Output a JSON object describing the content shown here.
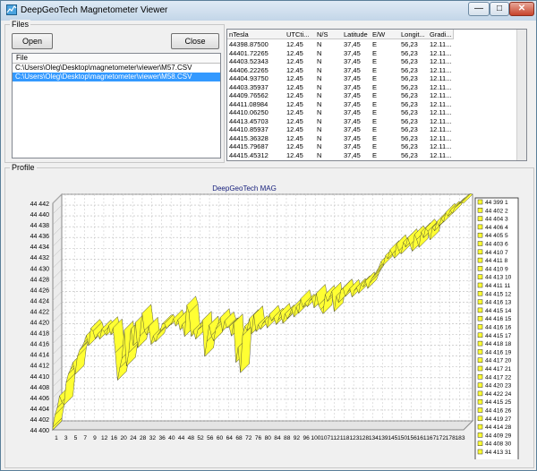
{
  "window": {
    "title": "DeepGeoTech Magnetometer Viewer",
    "min_glyph": "—",
    "max_glyph": "□",
    "close_glyph": "✕"
  },
  "files_group": {
    "legend": "Files",
    "open_label": "Open",
    "close_label": "Close",
    "list_header": "File",
    "items": [
      "C:\\Users\\Oleg\\Desktop\\magnetometer\\viewer\\M57.CSV",
      "C:\\Users\\Oleg\\Desktop\\magnetometer\\viewer\\M58.CSV"
    ],
    "selected": 1
  },
  "data_grid": {
    "columns": [
      "nTesla",
      "UTCti...",
      "N/S",
      "Latitude",
      "E/W",
      "Longit...",
      "Gradi..."
    ],
    "rows": [
      [
        "44398.87500",
        "12.45",
        "N",
        "37,45",
        "E",
        "56,23",
        "12.11..."
      ],
      [
        "44401.72265",
        "12.45",
        "N",
        "37,45",
        "E",
        "56,23",
        "12.11..."
      ],
      [
        "44403.52343",
        "12.45",
        "N",
        "37,45",
        "E",
        "56,23",
        "12.11..."
      ],
      [
        "44406.22265",
        "12.45",
        "N",
        "37,45",
        "E",
        "56,23",
        "12.11..."
      ],
      [
        "44404.93750",
        "12.45",
        "N",
        "37,45",
        "E",
        "56,23",
        "12.11..."
      ],
      [
        "44403.35937",
        "12.45",
        "N",
        "37,45",
        "E",
        "56,23",
        "12.11..."
      ],
      [
        "44409.76562",
        "12.45",
        "N",
        "37,45",
        "E",
        "56,23",
        "12.11..."
      ],
      [
        "44411.08984",
        "12.45",
        "N",
        "37,45",
        "E",
        "56,23",
        "12.11..."
      ],
      [
        "44410.06250",
        "12.45",
        "N",
        "37,45",
        "E",
        "56,23",
        "12.11..."
      ],
      [
        "44413.45703",
        "12.45",
        "N",
        "37,45",
        "E",
        "56,23",
        "12.11..."
      ],
      [
        "44410.85937",
        "12.45",
        "N",
        "37,45",
        "E",
        "56,23",
        "12.11..."
      ],
      [
        "44415.36328",
        "12.45",
        "N",
        "37,45",
        "E",
        "56,23",
        "12.11..."
      ],
      [
        "44415.79687",
        "12.45",
        "N",
        "37,45",
        "E",
        "56,23",
        "12.11..."
      ],
      [
        "44415.45312",
        "12.45",
        "N",
        "37,45",
        "E",
        "56,23",
        "12.11..."
      ]
    ]
  },
  "profile_group": {
    "legend": "Profile"
  },
  "chart_data": {
    "type": "area",
    "title": "DeepGeoTech MAG",
    "ylim": [
      44400,
      44442
    ],
    "yticks": [
      "44 400",
      "44 402",
      "44 404",
      "44 406",
      "44 408",
      "44 410",
      "44 412",
      "44 414",
      "44 416",
      "44 418",
      "44 420",
      "44 422",
      "44 424",
      "44 426",
      "44 428",
      "44 430",
      "44 432",
      "44 434",
      "44 436",
      "44 438",
      "44 440",
      "44 442"
    ],
    "xticks": [
      "1",
      "3",
      "5",
      "7",
      "9",
      "12",
      "16",
      "20",
      "24",
      "28",
      "32",
      "36",
      "40",
      "44",
      "48",
      "52",
      "56",
      "60",
      "64",
      "68",
      "72",
      "76",
      "80",
      "84",
      "88",
      "92",
      "96",
      "100",
      "107",
      "112",
      "118",
      "123",
      "128",
      "134",
      "139",
      "145",
      "150",
      "156",
      "161",
      "167",
      "172",
      "178",
      "183"
    ],
    "x_count": 185,
    "values": [
      44400.5,
      44402.8,
      44404.1,
      44406.3,
      44405.2,
      44404.6,
      44408.8,
      44410.4,
      44411.3,
      44412.5,
      44410.3,
      44413.6,
      44414.8,
      44415.4,
      44416.2,
      44417.5,
      44415.6,
      44418.8,
      44418.3,
      44416.9,
      44417.7,
      44416.8,
      44418.7,
      44418.2,
      44417.5,
      44419.3,
      44417.6,
      44418.9,
      44414.3,
      44409.2,
      44411.5,
      44413.3,
      44418.5,
      44411.8,
      44414.3,
      44418.7,
      44415.6,
      44419.9,
      44415.2,
      44417.4,
      44421.6,
      44418.4,
      44417.6,
      44419.2,
      44415.8,
      44417.4,
      44416.3,
      44417.6,
      44418.2,
      44419.6,
      44419.7,
      44418.8,
      44419.3,
      44419.5,
      44420.6,
      44419.2,
      44420.4,
      44418.5,
      44419.5,
      44417.3,
      44423.1,
      44421.7,
      44417.3,
      44418.4,
      44416.8,
      44418.6,
      44418.9,
      44420.3,
      44413.6,
      44416.4,
      44419.4,
      44417.5,
      44416.5,
      44418.7,
      44419.6,
      44420.8,
      44418.3,
      44420.2,
      44418.9,
      44419.1,
      44417.4,
      44419.8,
      44412.5,
      44415.3,
      44410.6,
      44417.5,
      44419.2,
      44418.4,
      44420.6,
      44417.8,
      44421.3,
      44418.2,
      44419.5,
      44418.6,
      44419.7,
      44420.3,
      44418.9,
      44421.4,
      44420.2,
      44420.9,
      44419.5,
      44420.4,
      44421.8,
      44419.7,
      44421.5,
      44420.6,
      44421.3,
      44422.5,
      44420.9,
      44422.8,
      44421.6,
      44424.3,
      44422.7,
      44423.5,
      44422.8,
      44423.9,
      44424.4,
      44422.6,
      44425.3,
      44423.1,
      44422.3,
      44421.5,
      44425.1,
      44423.8,
      44424.6,
      44425.7,
      44421.9,
      44424.8,
      44423.6,
      44425.9,
      44426.3,
      44424.7,
      44425.5,
      44426.2,
      44424.6,
      44425.8,
      44426.4,
      44425.3,
      44426.9,
      44426.5,
      44427.6,
      44426.2,
      44427.3,
      44428.1,
      44428.7,
      44429.4,
      44430.1,
      44431.2,
      44430.5,
      44432.3,
      44431.7,
      44433.4,
      44432.6,
      44431.8,
      44434.5,
      44433.2,
      44432.6,
      44434.8,
      44433.9,
      44435.6,
      44434.3,
      44433.1,
      44436.2,
      44435.3,
      44433.8,
      44436.7,
      44435.6,
      44437.4,
      44436.8,
      44435.2,
      44437.5,
      44436.9,
      44438.6,
      44437.8,
      44439.2,
      44438.5,
      44440.3,
      44439.6,
      44440.7,
      44440.1,
      44441.2,
      44441.5,
      44441.9,
      44442.1,
      44442.0
    ],
    "series_color": "#ffff33",
    "legend_entries": [
      "44 399 1",
      "44 402 2",
      "44 404 3",
      "44 406 4",
      "44 405 5",
      "44 403 6",
      "44 410 7",
      "44 411 8",
      "44 410 9",
      "44 413 10",
      "44 411 11",
      "44 415 12",
      "44 416 13",
      "44 415 14",
      "44 416 15",
      "44 416 16",
      "44 415 17",
      "44 418 18",
      "44 416 19",
      "44 417 20",
      "44 417 21",
      "44 417 22",
      "44 420 23",
      "44 422 24",
      "44 415 25",
      "44 416 26",
      "44 419 27",
      "44 414 28",
      "44 409 29",
      "44 408 30",
      "44 413 31"
    ]
  }
}
